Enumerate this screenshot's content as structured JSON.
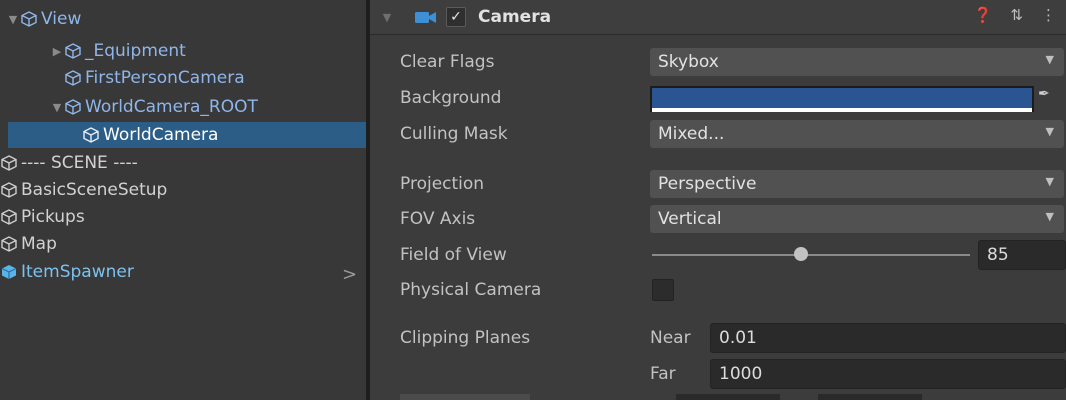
{
  "hierarchy": {
    "items": [
      {
        "label": "View",
        "style": "blue"
      },
      {
        "label": "_Equipment",
        "style": "blue"
      },
      {
        "label": "FirstPersonCamera",
        "style": "blue"
      },
      {
        "label": "WorldCamera_ROOT",
        "style": "blue"
      },
      {
        "label": "WorldCamera",
        "style": "sel"
      },
      {
        "label": "---- SCENE ----",
        "style": "normal"
      },
      {
        "label": "BasicSceneSetup",
        "style": "normal"
      },
      {
        "label": "Pickups",
        "style": "normal"
      },
      {
        "label": "Map",
        "style": "normal"
      },
      {
        "label": "ItemSpawner",
        "style": "prefab"
      }
    ],
    "selected": "WorldCamera"
  },
  "inspector": {
    "component_title": "Camera",
    "enabled": true,
    "header_icons": [
      "help-icon",
      "preset-icon",
      "more-icon"
    ],
    "properties": {
      "clear_flags": {
        "label": "Clear Flags",
        "value": "Skybox"
      },
      "background": {
        "label": "Background",
        "color": "#2b5592"
      },
      "culling_mask": {
        "label": "Culling Mask",
        "value": "Mixed..."
      },
      "projection": {
        "label": "Projection",
        "value": "Perspective"
      },
      "fov_axis": {
        "label": "FOV Axis",
        "value": "Vertical"
      },
      "field_of_view": {
        "label": "Field of View",
        "value": "85",
        "slider_fraction": 0.47
      },
      "physical_camera": {
        "label": "Physical Camera",
        "checked": false
      },
      "clipping_planes": {
        "label": "Clipping Planes",
        "near_label": "Near",
        "near_value": "0.01",
        "far_label": "Far",
        "far_value": "1000"
      }
    }
  },
  "colors": {
    "selection": "#2c5d87",
    "accent_blue": "#8fb6ea",
    "prefab": "#7cc2f0"
  }
}
